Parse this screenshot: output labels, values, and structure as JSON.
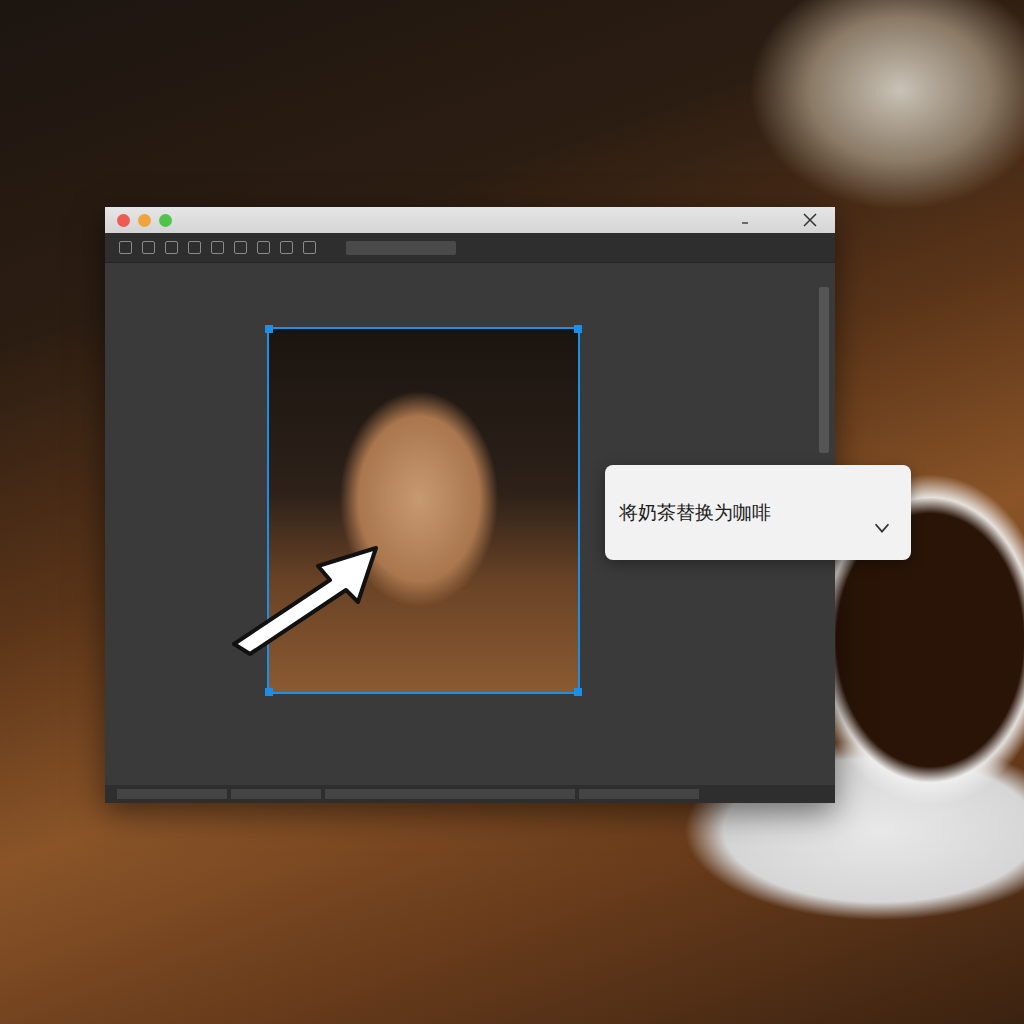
{
  "canvas": {
    "selection_active": true
  },
  "prompt": {
    "text": "将奶茶替换为咖啡"
  }
}
